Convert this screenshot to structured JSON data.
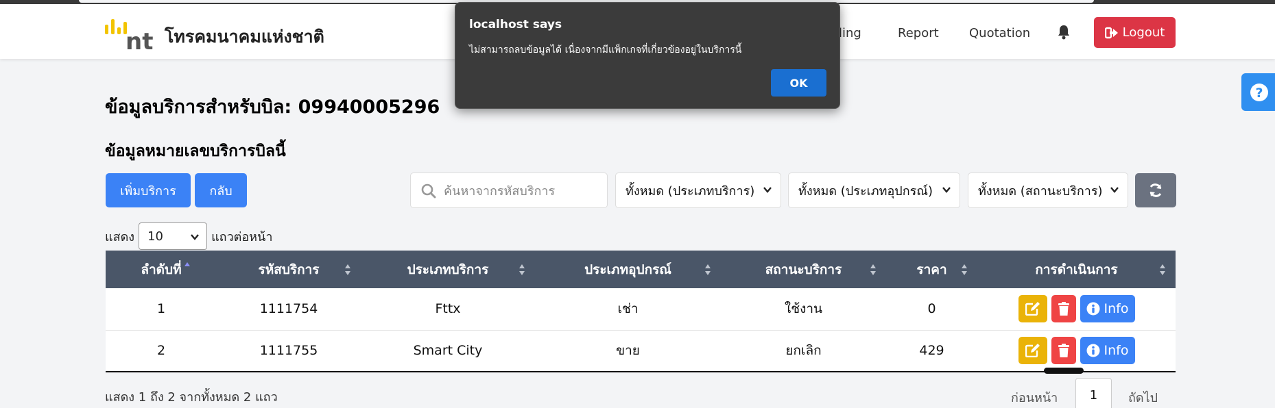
{
  "navbar": {
    "brand": "โทรคมนาคมแห่งชาติ",
    "logo_text": "nt",
    "links": [
      {
        "label": "lling"
      },
      {
        "label": "Report"
      },
      {
        "label": "Quotation"
      }
    ],
    "logout_label": "Logout",
    "colors": {
      "logout": "#dc3545",
      "logo_yellow": "#f2c400",
      "logo_gray": "#555555"
    }
  },
  "page": {
    "title": "ข้อมูลบริการสำหรับบิล: 09940005296",
    "subtitle": "ข้อมูลหมายเลขบริการบิลนี้"
  },
  "toolbar": {
    "add_label": "เพิ่มบริการ",
    "back_label": "กลับ",
    "search_placeholder": "ค้นหาจากรหัสบริการ",
    "filter_service_type": "ทั้งหมด (ประเภทบริการ)",
    "filter_equipment_type": "ทั้งหมด (ประเภทอุปกรณ์)",
    "filter_status": "ทั้งหมด (สถานะบริการ)"
  },
  "length": {
    "prefix": "แสดง",
    "value": "10",
    "suffix": "แถวต่อหน้า"
  },
  "table": {
    "headers": [
      "ลำดับที่",
      "รหัสบริการ",
      "ประเภทบริการ",
      "ประเภทอุปกรณ์",
      "สถานะบริการ",
      "ราคา",
      "การดำเนินการ"
    ],
    "rows": [
      {
        "no": "1",
        "service_id": "1111754",
        "service_type": "Fttx",
        "equipment_type": "เช่า",
        "status": "ใช้งาน",
        "price": "0",
        "info_label": "Info"
      },
      {
        "no": "2",
        "service_id": "1111755",
        "service_type": "Smart City",
        "equipment_type": "ขาย",
        "status": "ยกเลิก",
        "price": "429",
        "info_label": "Info"
      }
    ]
  },
  "footer": {
    "info": "แสดง 1 ถึง 2 จากทั้งหมด 2 แถว",
    "prev_label": "ก่อนหน้า",
    "current_page": "1",
    "next_label": "ถัดไป"
  },
  "dialog": {
    "title": "localhost says",
    "message": "ไม่สามารถลบข้อมูลได้ เนื่องจากมีแพ็กเกจที่เกี่ยวข้องอยู่ในบริการนี้",
    "ok_label": "OK"
  }
}
